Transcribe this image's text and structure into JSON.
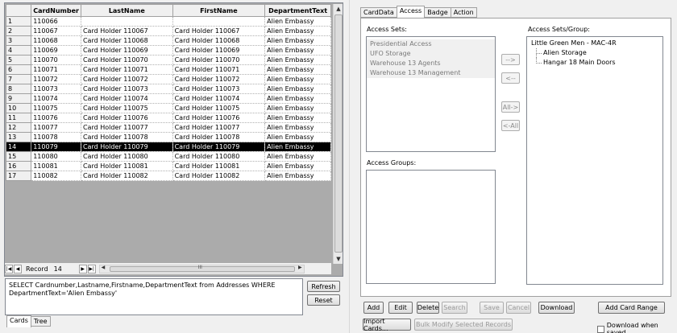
{
  "grid": {
    "columns": [
      "CardNumber",
      "LastName",
      "FirstName",
      "DepartmentText"
    ],
    "rows": [
      [
        "1",
        "110066",
        "",
        "",
        "Alien Embassy"
      ],
      [
        "2",
        "110067",
        "Card Holder 110067",
        "Card Holder 110067",
        "Alien Embassy"
      ],
      [
        "3",
        "110068",
        "Card Holder 110068",
        "Card Holder 110068",
        "Alien Embassy"
      ],
      [
        "4",
        "110069",
        "Card Holder 110069",
        "Card Holder 110069",
        "Alien Embassy"
      ],
      [
        "5",
        "110070",
        "Card Holder 110070",
        "Card Holder 110070",
        "Alien Embassy"
      ],
      [
        "6",
        "110071",
        "Card Holder 110071",
        "Card Holder 110071",
        "Alien Embassy"
      ],
      [
        "7",
        "110072",
        "Card Holder 110072",
        "Card Holder 110072",
        "Alien Embassy"
      ],
      [
        "8",
        "110073",
        "Card Holder 110073",
        "Card Holder 110073",
        "Alien Embassy"
      ],
      [
        "9",
        "110074",
        "Card Holder 110074",
        "Card Holder 110074",
        "Alien Embassy"
      ],
      [
        "10",
        "110075",
        "Card Holder 110075",
        "Card Holder 110075",
        "Alien Embassy"
      ],
      [
        "11",
        "110076",
        "Card Holder 110076",
        "Card Holder 110076",
        "Alien Embassy"
      ],
      [
        "12",
        "110077",
        "Card Holder 110077",
        "Card Holder 110077",
        "Alien Embassy"
      ],
      [
        "13",
        "110078",
        "Card Holder 110078",
        "Card Holder 110078",
        "Alien Embassy"
      ],
      [
        "14",
        "110079",
        "Card Holder 110079",
        "Card Holder 110079",
        "Alien Embassy"
      ],
      [
        "15",
        "110080",
        "Card Holder 110080",
        "Card Holder 110080",
        "Alien Embassy"
      ],
      [
        "16",
        "110081",
        "Card Holder 110081",
        "Card Holder 110081",
        "Alien Embassy"
      ],
      [
        "17",
        "110082",
        "Card Holder 110082",
        "Card Holder 110082",
        "Alien Embassy"
      ]
    ],
    "selected_row": "14"
  },
  "navigator": {
    "record_label": "Record",
    "record_value": "14",
    "first_icon": "first-record-icon",
    "prev_icon": "prev-record-icon",
    "next_icon": "next-record-icon",
    "last_icon": "last-record-icon"
  },
  "query": {
    "sql": "SELECT Cardnumber,Lastname,Firstname,DepartmentText from Addresses WHERE DepartmentText='Alien Embassy'",
    "refresh_label": "Refresh",
    "reset_label": "Reset"
  },
  "bottom_tabs": [
    {
      "label": "Cards",
      "active": true
    },
    {
      "label": "Tree",
      "active": false
    }
  ],
  "detail_tabs": [
    {
      "label": "CardData",
      "active": false
    },
    {
      "label": "Access",
      "active": true
    },
    {
      "label": "Badge",
      "active": false
    },
    {
      "label": "Action",
      "active": false
    }
  ],
  "access": {
    "sets_label": "Access Sets:",
    "sets": [
      "Presidential Access",
      "UFO Storage",
      "Warehouse 13 Agents",
      "Warehouse 13 Management"
    ],
    "groups_label": "Access Groups:",
    "assigned_label": "Access Sets/Group:",
    "assigned_root": "Little Green Men - MAC-4R",
    "assigned_children": [
      "Alien Storage",
      "Hangar 18 Main Doors"
    ],
    "move_right": "-->",
    "move_left": "<--",
    "move_all_right": "All->",
    "move_all_left": "<-All"
  },
  "actions": {
    "add": "Add",
    "edit": "Edit",
    "delete": "Delete",
    "search": "Search",
    "save": "Save",
    "cancel": "Cancel",
    "download": "Download",
    "add_card_range": "Add Card Range",
    "import_cards": "Import Cards...",
    "bulk_modify": "Bulk Modify Selected Records",
    "download_when_saved": "Download when saved"
  },
  "colors": {
    "selection": "#000000",
    "panel": "#f0f0f0",
    "disabled_text": "#9a9a9a"
  }
}
